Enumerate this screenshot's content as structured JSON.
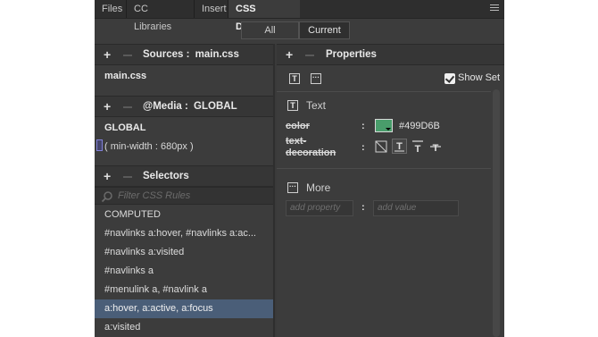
{
  "tabs": [
    {
      "label": "Files"
    },
    {
      "label": "CC Libraries"
    },
    {
      "label": "Insert"
    },
    {
      "label": "CSS Designer"
    }
  ],
  "toggle": {
    "all": "All",
    "current": "Current"
  },
  "sources": {
    "header_label": "Sources :",
    "header_file": "main.css",
    "items": [
      "main.css"
    ]
  },
  "media": {
    "header_label": "@Media :",
    "header_value": "GLOBAL",
    "items": [
      "GLOBAL",
      "( min-width : 680px )"
    ]
  },
  "selectors": {
    "header_label": "Selectors",
    "filter_placeholder": "Filter CSS Rules",
    "items": [
      "COMPUTED",
      "#navlinks a:hover, #navlinks a:ac...",
      "#navlinks a:visited",
      "#navlinks a",
      "#menulink a, #navlink a",
      "a:hover, a:active, a:focus",
      "a:visited"
    ],
    "selected_index": 5
  },
  "properties": {
    "header_label": "Properties",
    "show_set_label": "Show Set",
    "show_set_checked": true,
    "text_section": "Text",
    "color_label": "color",
    "color_value": "#499D6B",
    "text_decoration_label_1": "text-",
    "text_decoration_label_2": "decoration",
    "more_section": "More",
    "add_property_placeholder": "add property",
    "add_value_placeholder": "add value"
  },
  "colors": {
    "accent_swatch": "#499D6B",
    "selected_row": "#4a5e78",
    "panel_bg": "#3c3c3c"
  }
}
